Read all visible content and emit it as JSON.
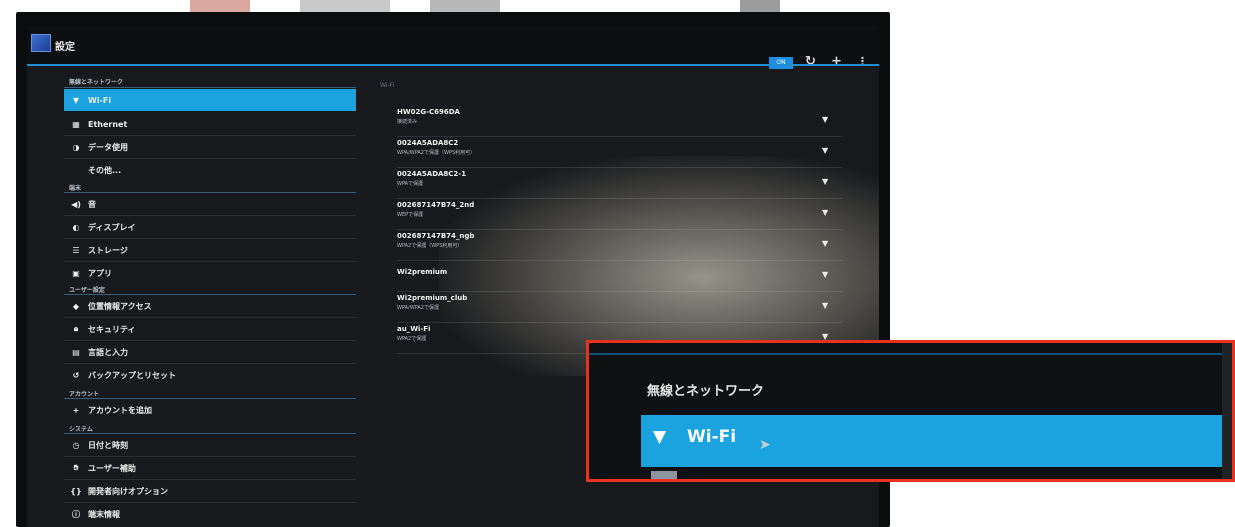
{
  "window": {
    "title": "設定"
  },
  "actionbar": {
    "toggle_label": "ON",
    "icons": [
      "refresh-icon",
      "add-icon",
      "overflow-menu-icon"
    ]
  },
  "leftlist": {
    "sections": [
      {
        "header": "無線とネットワーク",
        "items": [
          {
            "label": "Wi-Fi",
            "icon": "wifi-icon",
            "selected": true
          },
          {
            "label": "Ethernet",
            "icon": "ethernet-icon"
          },
          {
            "label": "データ使用",
            "icon": "data-usage-icon"
          },
          {
            "label": "その他...",
            "icon": ""
          }
        ]
      },
      {
        "header": "端末",
        "items": [
          {
            "label": "音",
            "icon": "sound-icon"
          },
          {
            "label": "ディスプレイ",
            "icon": "display-icon"
          },
          {
            "label": "ストレージ",
            "icon": "storage-icon"
          },
          {
            "label": "アプリ",
            "icon": "apps-icon"
          }
        ]
      },
      {
        "header": "ユーザー設定",
        "items": [
          {
            "label": "位置情報アクセス",
            "icon": "location-icon"
          },
          {
            "label": "セキュリティ",
            "icon": "lock-icon"
          },
          {
            "label": "言語と入力",
            "icon": "keyboard-icon"
          },
          {
            "label": "バックアップとリセット",
            "icon": "backup-icon"
          }
        ]
      },
      {
        "header": "アカウント",
        "items": [
          {
            "label": "アカウントを追加",
            "icon": "add-icon"
          }
        ]
      },
      {
        "header": "システム",
        "items": [
          {
            "label": "日付と時刻",
            "icon": "clock-icon"
          },
          {
            "label": "ユーザー補助",
            "icon": "accessibility-icon"
          },
          {
            "label": "開発者向けオプション",
            "icon": "developer-icon"
          },
          {
            "label": "端末情報",
            "icon": "info-icon"
          }
        ]
      }
    ]
  },
  "wifi_panel": {
    "header": "Wi-Fi",
    "networks": [
      {
        "ssid": "HW02G-C696DA",
        "status": "接続済み"
      },
      {
        "ssid": "0024A5ADA8C2",
        "status": "WPA/WPA2で保護（WPS利用可）"
      },
      {
        "ssid": "0024A5ADA8C2-1",
        "status": "WPAで保護"
      },
      {
        "ssid": "002687147B74_2nd",
        "status": "WEPで保護"
      },
      {
        "ssid": "002687147B74_ngb",
        "status": "WPA2で保護（WPS利用可）"
      },
      {
        "ssid": "Wi2premium",
        "status": ""
      },
      {
        "ssid": "Wi2premium_club",
        "status": "WPA/WPA2で保護"
      },
      {
        "ssid": "au_Wi-Fi",
        "status": "WPA2で保護"
      }
    ]
  },
  "callout": {
    "header": "無線とネットワーク",
    "selected_label": "Wi-Fi"
  },
  "colors": {
    "accent": "#1aa3df",
    "callout_border": "#e8311f",
    "divider": "#1f8fd1"
  }
}
